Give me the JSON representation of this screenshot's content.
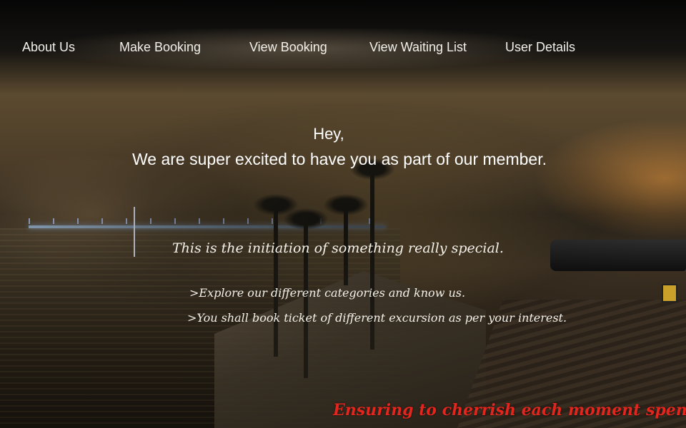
{
  "nav": {
    "items": [
      {
        "label": "About Us"
      },
      {
        "label": "Make Booking"
      },
      {
        "label": "View Booking"
      },
      {
        "label": "View Waiting List"
      },
      {
        "label": "User Details"
      }
    ]
  },
  "welcome": {
    "greeting": "Hey,",
    "headline": "We are super excited to have you as part of our member.",
    "tagline": "This is the initiation of something really special.",
    "points": [
      ">Explore our different categories and know us.",
      ">You shall book ticket of different excursion as per your interest."
    ]
  },
  "footer": {
    "note": "Ensuring to cherrish each moment spent with us. ."
  }
}
